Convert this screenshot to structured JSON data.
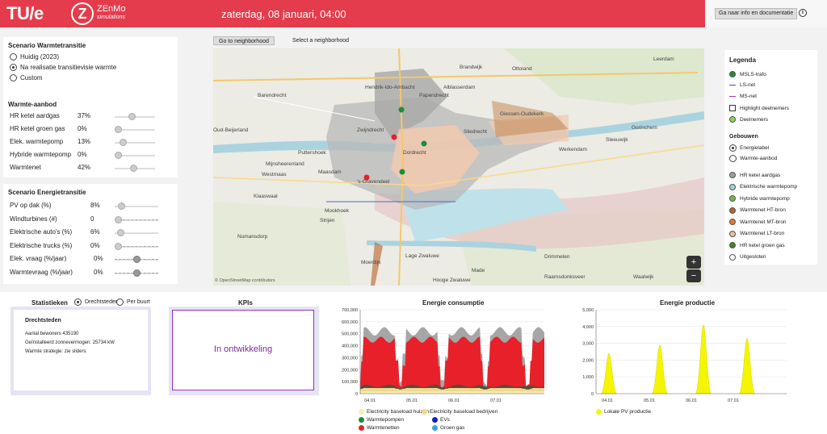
{
  "header": {
    "brand": "TU/e",
    "logo_letter": "Z",
    "logo_name": "ZEnMo",
    "logo_sub": "simulations",
    "datetime": "zaterdag, 08 januari, 04:00",
    "doc_button": "Ga naar info en documentatie",
    "info_icon": "info-icon"
  },
  "scenario_warmte": {
    "title": "Scenario Warmtetransitie",
    "options": [
      {
        "label": "Huidig (2023)",
        "selected": false
      },
      {
        "label": "Na realisatie transitievisie warmte",
        "selected": true
      },
      {
        "label": "Custom",
        "selected": false
      }
    ]
  },
  "warmte_aanbod": {
    "title": "Warmte-aanbod",
    "rows": [
      {
        "label": "HR ketel aardgas",
        "value": "37%",
        "level": 0.37
      },
      {
        "label": "HR ketel groen gas",
        "value": "0%",
        "level": 0
      },
      {
        "label": "Elek. warmtepomp",
        "value": "13%",
        "level": 0.13
      },
      {
        "label": "Hybride warmtepomp",
        "value": "0%",
        "level": 0
      },
      {
        "label": "Warmtenet",
        "value": "42%",
        "level": 0.42
      }
    ]
  },
  "scenario_energie": {
    "title": "Scenario Energietransitie",
    "rows": [
      {
        "label": "PV op dak (%)",
        "value": "8%",
        "level": 0.08
      },
      {
        "label": "Windturbines (#)",
        "value": "0",
        "level": 0
      },
      {
        "label": "Elektrische auto's (%)",
        "value": "6%",
        "level": 0.06
      },
      {
        "label": "Elektrische trucks (%)",
        "value": "0%",
        "level": 0
      },
      {
        "label": "Elek. vraag (%/jaar)",
        "value": "0%",
        "level": 0.5
      },
      {
        "label": "Warmtevraag (%/jaar)",
        "value": "0%",
        "level": 0.5
      }
    ]
  },
  "map": {
    "tab_active": "Go to neighborhood",
    "tab_other": "Select a neighborhood",
    "zoom_in": "+",
    "zoom_out": "−",
    "attribution": "© OpenStreetMap contributors",
    "places": [
      "Barendrecht",
      "Hendrik-Ido-Ambacht",
      "Oud-Beijerland",
      "Puttershoek",
      "Mijnsheerenland",
      "Westmaas",
      "Maasdam",
      "'s-Gravendeel",
      "Klaaswaal",
      "Mookhoek",
      "Strijen",
      "Numansdorp",
      "Lage Zwaluwe",
      "Moerdijk",
      "Hooge Zwaluwe",
      "Raamsdonksveer",
      "Waalwijk",
      "Made",
      "Drimmelen",
      "Gorinchem",
      "Werkendam",
      "Giessen-Oudekerk",
      "Leerdam",
      "Ottoland",
      "Brandwijk",
      "Sleeuwijk",
      "Sliedrecht",
      "Papendrecht",
      "Zwijndrecht",
      "Dordrecht",
      "Alblasserdam"
    ]
  },
  "legend": {
    "title": "Legenda",
    "items": [
      {
        "label": "MSLS-trafo",
        "color": "#1a8f3a",
        "shape": "dot"
      },
      {
        "label": "LS-net",
        "color": "#3a4bd4",
        "shape": "line"
      },
      {
        "label": "MS-net",
        "color": "#9b30c0",
        "shape": "line"
      },
      {
        "label": "Highlight deelnemers",
        "color": "#ffffff",
        "shape": "square"
      },
      {
        "label": "Deelnemers",
        "color": "#88d84a",
        "shape": "dot"
      }
    ],
    "gebouwen_title": "Gebouwen",
    "gebouwen_options": [
      {
        "label": "Energielabel",
        "selected": true
      },
      {
        "label": "Warmte-aanbod",
        "selected": false
      }
    ],
    "building_items": [
      {
        "label": "HR ketel aardgas",
        "color": "#9e9e9e"
      },
      {
        "label": "Elektrische warmtepomp",
        "color": "#9fd2e0"
      },
      {
        "label": "Hybride warmtepomp",
        "color": "#7ab648"
      },
      {
        "label": "Warmtenet HT-bron",
        "color": "#b9612a"
      },
      {
        "label": "Warmtenet MT-bron",
        "color": "#e07b3a"
      },
      {
        "label": "Warmtenet LT-bron",
        "color": "#f2b99a"
      },
      {
        "label": "HR ketel groen gas",
        "color": "#4e7d2a"
      },
      {
        "label": "Uitgesloten",
        "color": "#ffffff"
      }
    ]
  },
  "statistieken": {
    "title": "Statistieken",
    "toggle": [
      {
        "label": "Drechtsteden",
        "selected": true
      },
      {
        "label": "Per buurt",
        "selected": false
      }
    ],
    "card_title": "Drechtsteden",
    "lines": [
      "Aantal bewoners 435190",
      "Geïnstalleerd zonnevermogen: 25734 kW",
      "Warmte strategie: zie sliders"
    ]
  },
  "kpis": {
    "title": "KPIs",
    "text": "In ontwikkeling"
  },
  "chart_data": [
    {
      "type": "area",
      "title": "Energie consumptie",
      "ylim": [
        0,
        700000
      ],
      "yticks": [
        "700,000",
        "600,000",
        "500,000",
        "400,000",
        "300,000",
        "200,000",
        "100,000",
        "0"
      ],
      "xticks": [
        "04.01",
        "05.01",
        "06.01",
        "07.01"
      ],
      "series": [
        {
          "name": "Electricity baseload huizen",
          "color": "#f5efb0"
        },
        {
          "name": "Electricity baseload bedrijven",
          "color": "#f0d890"
        },
        {
          "name": "Warmtepompen",
          "color": "#1a8f3a"
        },
        {
          "name": "EVs",
          "color": "#1020c0"
        },
        {
          "name": "Warmtenetten",
          "color": "#e8202a"
        },
        {
          "name": "Groen gas",
          "color": "#3aa0e0"
        }
      ],
      "legend": [
        "Electricity baseload huizen",
        "Electricity baseload bedrijven",
        "Warmtepompen",
        "EVs",
        "Warmtenetten",
        "Groen gas"
      ]
    },
    {
      "type": "area",
      "title": "Energie productie",
      "ylim": [
        0,
        5000
      ],
      "yticks": [
        "5,000",
        "4,000",
        "3,000",
        "2,000",
        "1,000",
        "0"
      ],
      "xticks": [
        "04.01",
        "05.01",
        "06.01",
        "07.01"
      ],
      "series": [
        {
          "name": "Lokale PV productie",
          "color": "#f5f500",
          "peaks": [
            2400,
            2900,
            4100,
            3300
          ]
        }
      ],
      "legend": [
        "Lokale PV productie"
      ]
    }
  ]
}
